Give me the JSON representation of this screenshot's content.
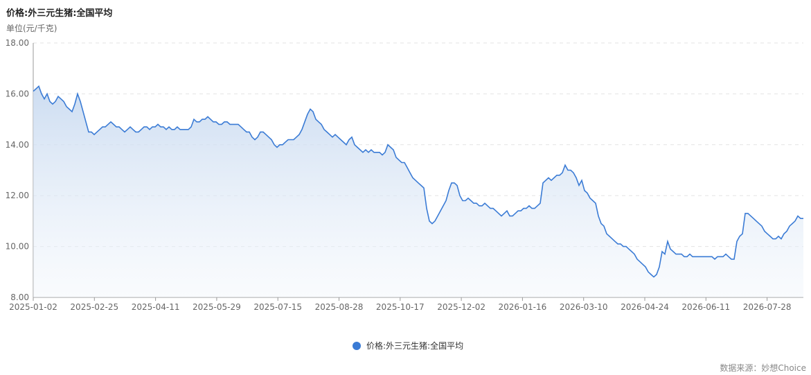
{
  "chart_data": {
    "type": "area",
    "title": "价格:外三元生猪:全国平均",
    "ylabel": "单位(元/千克)",
    "ylim": [
      8,
      18
    ],
    "yticks": [
      "8.00",
      "10.00",
      "12.00",
      "14.00",
      "16.00",
      "18.00"
    ],
    "xticks": [
      "2025-01-02",
      "2025-02-25",
      "2025-04-11",
      "2025-05-29",
      "2025-07-15",
      "2025-08-28",
      "2025-10-17",
      "2025-12-02",
      "2026-01-16",
      "2026-03-10",
      "2026-04-24",
      "2026-06-11",
      "2026-07-28"
    ],
    "grid": true,
    "legend_position": "bottom",
    "series": [
      {
        "name": "价格:外三元生猪:全国平均",
        "color": "#3a7bd5",
        "values": [
          16.1,
          16.2,
          16.3,
          16.0,
          15.8,
          16.0,
          15.7,
          15.6,
          15.7,
          15.9,
          15.8,
          15.7,
          15.5,
          15.4,
          15.3,
          15.6,
          16.0,
          15.7,
          15.3,
          14.9,
          14.5,
          14.5,
          14.4,
          14.5,
          14.6,
          14.7,
          14.7,
          14.8,
          14.9,
          14.8,
          14.7,
          14.7,
          14.6,
          14.5,
          14.6,
          14.7,
          14.6,
          14.5,
          14.5,
          14.6,
          14.7,
          14.7,
          14.6,
          14.7,
          14.7,
          14.8,
          14.7,
          14.7,
          14.6,
          14.7,
          14.6,
          14.6,
          14.7,
          14.6,
          14.6,
          14.6,
          14.6,
          14.7,
          15.0,
          14.9,
          14.9,
          15.0,
          15.0,
          15.1,
          15.0,
          14.9,
          14.9,
          14.8,
          14.8,
          14.9,
          14.9,
          14.8,
          14.8,
          14.8,
          14.8,
          14.7,
          14.6,
          14.5,
          14.5,
          14.3,
          14.2,
          14.3,
          14.5,
          14.5,
          14.4,
          14.3,
          14.2,
          14.0,
          13.9,
          14.0,
          14.0,
          14.1,
          14.2,
          14.2,
          14.2,
          14.3,
          14.4,
          14.6,
          14.9,
          15.2,
          15.4,
          15.3,
          15.0,
          14.9,
          14.8,
          14.6,
          14.5,
          14.4,
          14.3,
          14.4,
          14.3,
          14.2,
          14.1,
          14.0,
          14.2,
          14.3,
          14.0,
          13.9,
          13.8,
          13.7,
          13.8,
          13.7,
          13.8,
          13.7,
          13.7,
          13.7,
          13.6,
          13.7,
          14.0,
          13.9,
          13.8,
          13.5,
          13.4,
          13.3,
          13.3,
          13.1,
          12.9,
          12.7,
          12.6,
          12.5,
          12.4,
          12.3,
          11.5,
          11.0,
          10.9,
          11.0,
          11.2,
          11.4,
          11.6,
          11.8,
          12.2,
          12.5,
          12.5,
          12.4,
          12.0,
          11.8,
          11.8,
          11.9,
          11.8,
          11.7,
          11.7,
          11.6,
          11.6,
          11.7,
          11.6,
          11.5,
          11.5,
          11.4,
          11.3,
          11.2,
          11.3,
          11.4,
          11.2,
          11.2,
          11.3,
          11.4,
          11.4,
          11.5,
          11.5,
          11.6,
          11.5,
          11.5,
          11.6,
          11.7,
          12.5,
          12.6,
          12.7,
          12.6,
          12.7,
          12.8,
          12.8,
          12.9,
          13.2,
          13.0,
          13.0,
          12.9,
          12.7,
          12.4,
          12.6,
          12.2,
          12.1,
          11.9,
          11.8,
          11.7,
          11.2,
          10.9,
          10.8,
          10.5,
          10.4,
          10.3,
          10.2,
          10.1,
          10.1,
          10.0,
          10.0,
          9.9,
          9.8,
          9.7,
          9.5,
          9.4,
          9.3,
          9.2,
          9.0,
          8.9,
          8.8,
          8.9,
          9.2,
          9.8,
          9.7,
          10.2,
          9.9,
          9.8,
          9.7,
          9.7,
          9.7,
          9.6,
          9.6,
          9.7,
          9.6,
          9.6,
          9.6,
          9.6,
          9.6,
          9.6,
          9.6,
          9.6,
          9.5,
          9.6,
          9.6,
          9.6,
          9.7,
          9.6,
          9.5,
          9.5,
          10.2,
          10.4,
          10.5,
          11.3,
          11.3,
          11.2,
          11.1,
          11.0,
          10.9,
          10.8,
          10.6,
          10.5,
          10.4,
          10.3,
          10.3,
          10.4,
          10.3,
          10.5,
          10.6,
          10.8,
          10.9,
          11.0,
          11.2,
          11.1,
          11.1
        ]
      }
    ]
  },
  "footer": {
    "source": "数据来源：妙想Choice"
  }
}
